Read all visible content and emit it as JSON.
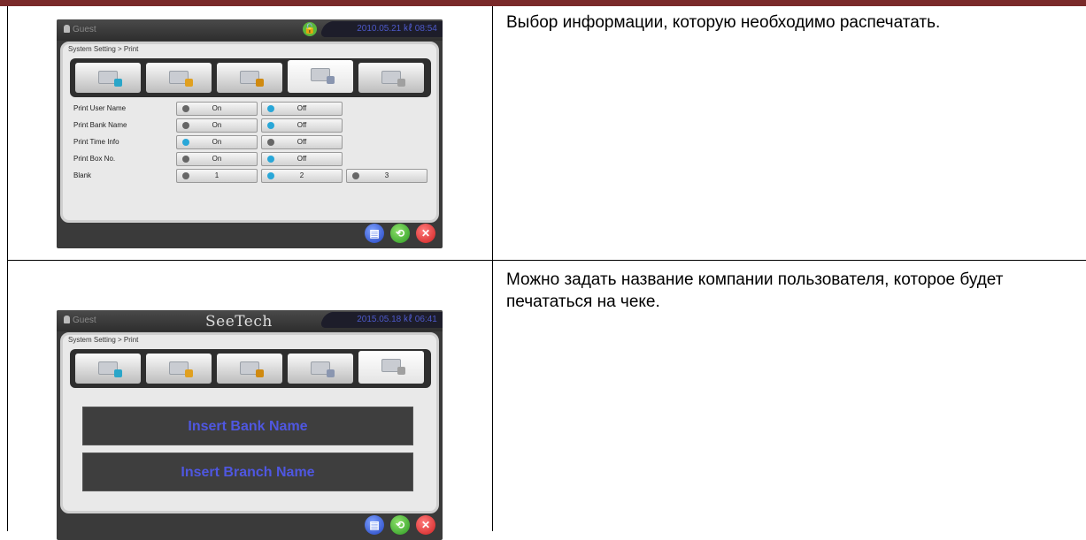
{
  "rows": [
    {
      "screen": {
        "user": "Guest",
        "datetime": "2010.05.21 ㎘ 08:54",
        "breadcrumb": "System Setting > Print",
        "settings": [
          {
            "label": "Print User Name",
            "options": [
              "On",
              "Off"
            ],
            "selected": 1
          },
          {
            "label": "Print Bank Name",
            "options": [
              "On",
              "Off"
            ],
            "selected": 1
          },
          {
            "label": "Print Time Info",
            "options": [
              "On",
              "Off"
            ],
            "selected": 0
          },
          {
            "label": "Print Box No.",
            "options": [
              "On",
              "Off"
            ],
            "selected": 1
          },
          {
            "label": "Blank",
            "options": [
              "1",
              "2",
              "3"
            ],
            "selected": 1
          }
        ]
      },
      "description": "Выбор информации, которую необходимо распечатать."
    },
    {
      "screen": {
        "user": "Guest",
        "logo": "SeeTech",
        "datetime": "2015.05.18 ㎘ 06:41",
        "breadcrumb": "System Setting > Print",
        "fields": [
          "Insert Bank Name",
          "Insert Branch Name"
        ]
      },
      "description": "Можно задать название компании пользователя, которое будет печататься на чеке."
    }
  ],
  "icons": {
    "save": "save-icon",
    "back": "return-icon",
    "close": "close-icon",
    "lock": "unlock-icon"
  },
  "colors": {
    "accent_bar": "#7a2a2a",
    "selected_dot": "#29a7d8",
    "insert_text": "#4f57e0"
  }
}
